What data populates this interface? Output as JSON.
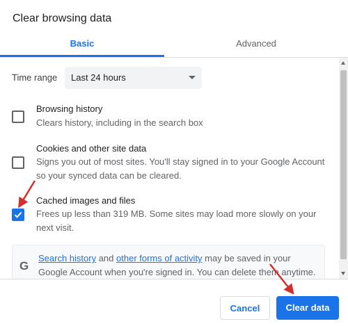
{
  "dialog": {
    "title": "Clear browsing data"
  },
  "tabs": [
    {
      "label": "Basic",
      "selected": true
    },
    {
      "label": "Advanced",
      "selected": false
    }
  ],
  "time_range": {
    "label": "Time range",
    "value": "Last 24 hours"
  },
  "items": [
    {
      "title": "Browsing history",
      "description": "Clears history, including in the search box",
      "checked": false
    },
    {
      "title": "Cookies and other site data",
      "description": "Signs you out of most sites. You'll stay signed in to your Google Account so your synced data can be cleared.",
      "checked": false
    },
    {
      "title": "Cached images and files",
      "description": "Frees up less than 319 MB. Some sites may load more slowly on your next visit.",
      "checked": true
    }
  ],
  "info": {
    "icon": "google-g-icon",
    "link1": "Search history",
    "text1": " and ",
    "link2": "other forms of activity",
    "text2": " may be saved in your Google Account when you're signed in. You can delete them anytime."
  },
  "footer": {
    "cancel_label": "Cancel",
    "clear_label": "Clear data"
  },
  "colors": {
    "accent": "#1a73e8",
    "annotation_arrow": "#d32f2f"
  }
}
